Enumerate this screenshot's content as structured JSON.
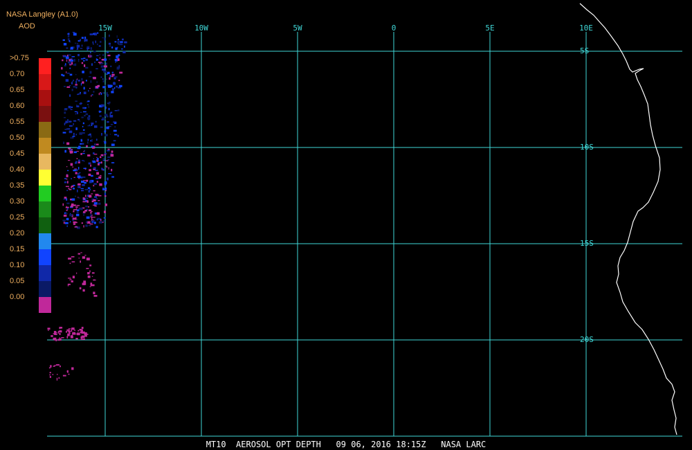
{
  "header": {
    "title": "NASA Langley (A1.0)",
    "subtitle": "AOD"
  },
  "legend": {
    "entries": [
      {
        "label": ">0.75",
        "color": "#ff2020"
      },
      {
        "label": "0.70",
        "color": "#d81818"
      },
      {
        "label": "0.65",
        "color": "#a81010"
      },
      {
        "label": "0.60",
        "color": "#7a1010"
      },
      {
        "label": "0.55",
        "color": "#8a6a14"
      },
      {
        "label": "0.50",
        "color": "#c08a20"
      },
      {
        "label": "0.45",
        "color": "#e8b860"
      },
      {
        "label": "0.40",
        "color": "#ffff33"
      },
      {
        "label": "0.35",
        "color": "#22cc22"
      },
      {
        "label": "0.30",
        "color": "#1a8a1a"
      },
      {
        "label": "0.25",
        "color": "#106010"
      },
      {
        "label": "0.20",
        "color": "#2288ee"
      },
      {
        "label": "0.15",
        "color": "#1144ff"
      },
      {
        "label": "0.10",
        "color": "#1028a8"
      },
      {
        "label": "0.05",
        "color": "#0a1a66"
      },
      {
        "label": "0.00",
        "color": "#c0289a"
      }
    ]
  },
  "axes": {
    "longitude_labels": [
      "15W",
      "10W",
      "5W",
      "0",
      "5E",
      "10E"
    ],
    "latitude_labels": [
      "5S",
      "10S",
      "15S",
      "20S"
    ]
  },
  "footer": {
    "text": "MT10  AEROSOL OPT DEPTH   09 06, 2016 18:15Z   NASA LARC"
  },
  "colors": {
    "grid": "#40d8d8",
    "label": "#f0b060",
    "coast": "#ffffff",
    "background": "#000000"
  }
}
